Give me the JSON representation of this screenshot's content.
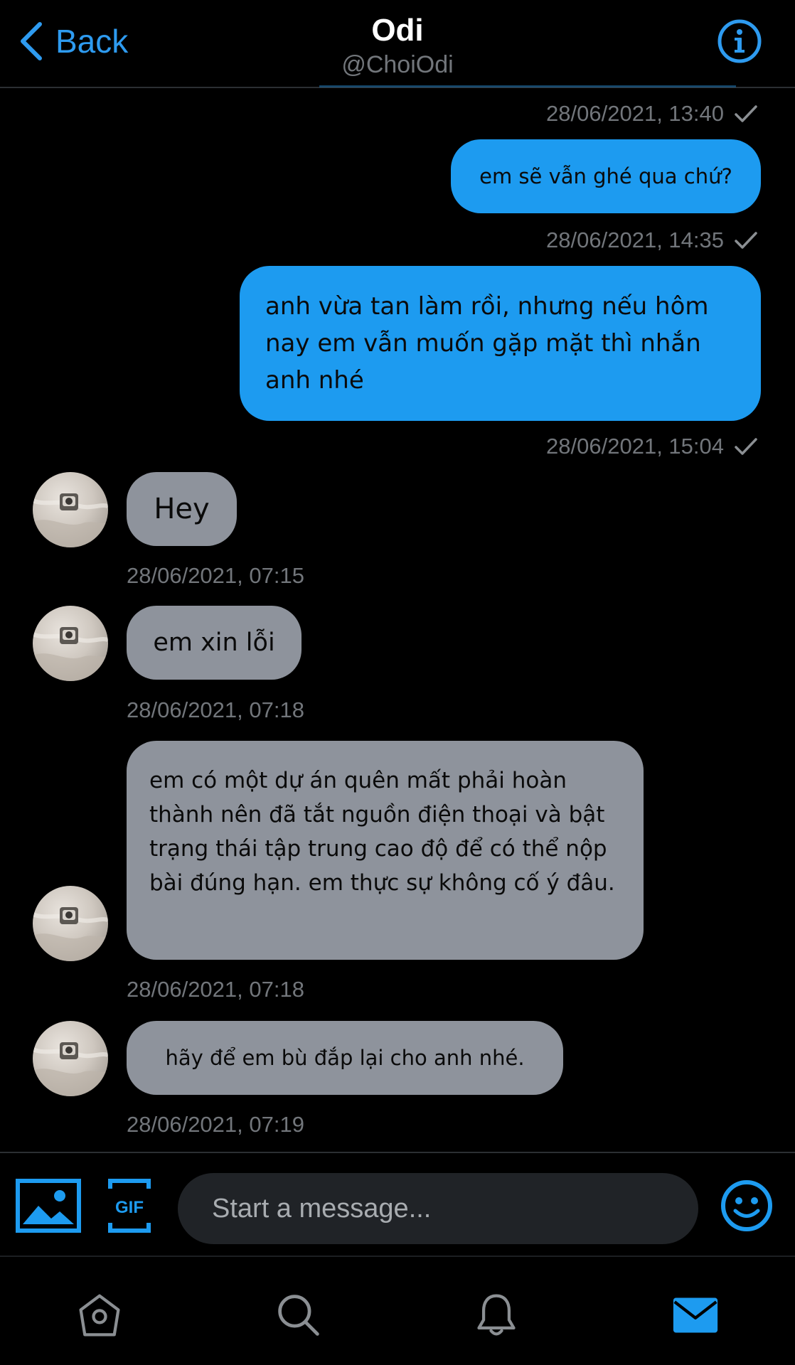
{
  "header": {
    "back_label": "Back",
    "title": "Odi",
    "handle": "@ChoiOdi",
    "info_icon": "info-circle-icon"
  },
  "messages": [
    {
      "direction": "outgoing",
      "timestamp": "28/06/2021, 13:40",
      "read": true,
      "text": "em sẽ vẫn ghé qua chứ?"
    },
    {
      "direction": "outgoing",
      "timestamp": "28/06/2021, 14:35",
      "read": true,
      "text": "anh vừa tan làm rồi, nhưng nếu hôm nay em vẫn muốn gặp mặt thì nhắn anh nhé"
    },
    {
      "direction": "outgoing_timestamp",
      "timestamp": "28/06/2021, 15:04",
      "read": true
    },
    {
      "direction": "incoming",
      "text": "Hey",
      "timestamp": "28/06/2021, 07:15"
    },
    {
      "direction": "incoming",
      "text": "em xin lỗi",
      "timestamp": "28/06/2021, 07:18"
    },
    {
      "direction": "incoming",
      "text": "em có một dự án quên mất phải hoàn thành nên đã tắt nguồn điện thoại và bật trạng thái tập trung cao độ để có thể nộp bài đúng hạn. em thực sự không cố ý đâu.",
      "timestamp": "28/06/2021, 07:18"
    },
    {
      "direction": "incoming",
      "text": "hãy để em bù đắp lại cho anh nhé.",
      "timestamp": "28/06/2021, 07:19"
    }
  ],
  "composer": {
    "placeholder": "Start a message...",
    "image_icon": "image-icon",
    "gif_label": "GIF",
    "emoji_icon": "emoji-smile-icon"
  },
  "tabbar": {
    "items": [
      "home-icon",
      "search-icon",
      "notifications-bell-icon",
      "messages-envelope-icon"
    ],
    "active": "messages-envelope-icon"
  },
  "colors": {
    "accent": "#1d9bf0",
    "incoming_bubble": "#8e939c",
    "background": "#000000",
    "muted_text": "#72767b"
  }
}
